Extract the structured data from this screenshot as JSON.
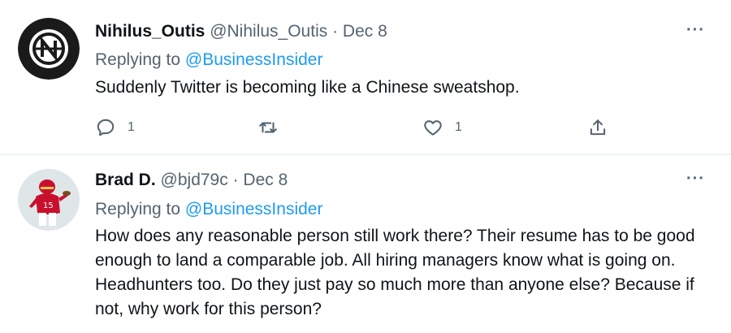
{
  "tweets": [
    {
      "display_name": "Nihilus_Outis",
      "handle": "@Nihilus_Outis",
      "separator": "·",
      "date": "Dec 8",
      "replying_label": "Replying to",
      "replying_to": "@BusinessInsider",
      "text": "Suddenly Twitter is becoming like a Chinese sweatshop.",
      "reply_count": "1",
      "like_count": "1",
      "more_label": "···"
    },
    {
      "display_name": "Brad D.",
      "handle": "@bjd79c",
      "separator": "·",
      "date": "Dec 8",
      "replying_label": "Replying to",
      "replying_to": "@BusinessInsider",
      "text": "How does any reasonable person still work there? Their resume has to be good enough to land a comparable job. All hiring managers know what is going on. Headhunters too. Do they just pay so much more than anyone else?  Because if not, why work for this person?",
      "more_label": "···"
    }
  ],
  "colors": {
    "link": "#1d9bf0",
    "secondary_text": "#536471",
    "primary_text": "#0f1419",
    "divider": "#eff3f4"
  },
  "icons": {
    "tweet1_avatar": "crossed-circle-logo",
    "tweet2_avatar": "football-player-photo",
    "reply": "reply-icon",
    "retweet": "retweet-icon",
    "like": "heart-icon",
    "share": "share-icon",
    "more": "more-icon"
  }
}
